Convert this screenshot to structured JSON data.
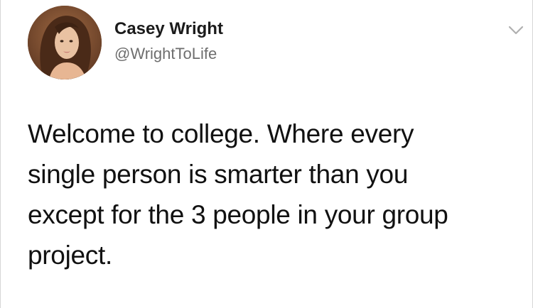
{
  "tweet": {
    "author_name": "Casey Wright",
    "author_handle": "@WrightToLife",
    "text_lines": [
      "Welcome to college. Where every",
      "single person is smarter than you",
      "except for the 3 people in your group",
      "project."
    ]
  },
  "icons": {
    "avatar": "profile-photo",
    "menu": "chevron-down-icon"
  },
  "colors": {
    "name": "#1b1b1b",
    "handle": "#6e6e6e",
    "text": "#111111",
    "chevron": "#b0b0b0"
  }
}
